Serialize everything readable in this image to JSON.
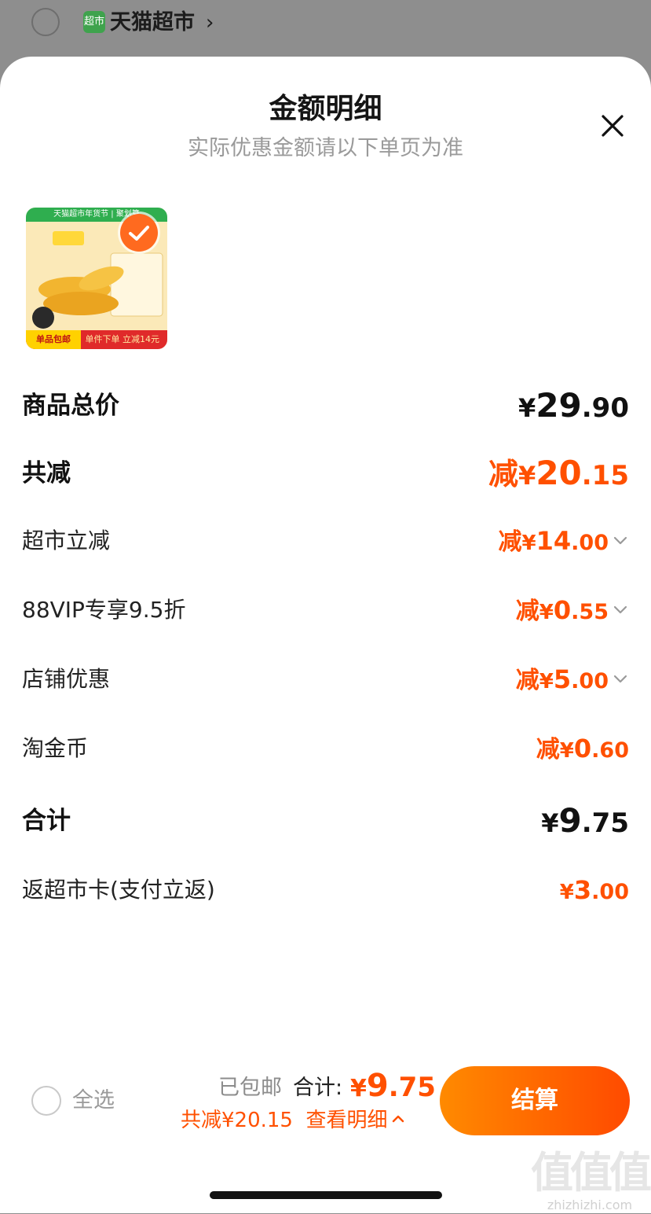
{
  "store": {
    "logo_text": "超市",
    "name": "天猫超市",
    "chevron": "›"
  },
  "sheet": {
    "title": "金额明细",
    "subtitle": "实际优惠金额请以下单页为准",
    "close_icon": "close-icon"
  },
  "product": {
    "banner_top": "天猫超市年货节 | 聚划算",
    "tag": "单品包邮",
    "banner_bottom": "单件下单 立减14元",
    "selected": true,
    "check_icon": "check-icon"
  },
  "rows": [
    {
      "label": "商品总价",
      "prefix": "",
      "symbol": "¥",
      "int": "29",
      "dec": ".90",
      "style": "bold-black",
      "chevron": false
    },
    {
      "label": "共减",
      "prefix": "减",
      "symbol": "¥",
      "int": "20",
      "dec": ".15",
      "style": "bold-orange",
      "chevron": false
    },
    {
      "label": "超市立减",
      "prefix": "减",
      "symbol": "¥",
      "int": "14",
      "dec": ".00",
      "style": "normal-orange",
      "chevron": true
    },
    {
      "label": "88VIP专享9.5折",
      "prefix": "减",
      "symbol": "¥",
      "int": "0",
      "dec": ".55",
      "style": "normal-orange",
      "chevron": true
    },
    {
      "label": "店铺优惠",
      "prefix": "减",
      "symbol": "¥",
      "int": "5",
      "dec": ".00",
      "style": "normal-orange",
      "chevron": true
    },
    {
      "label": "淘金币",
      "prefix": "减",
      "symbol": "¥",
      "int": "0",
      "dec": ".60",
      "style": "normal-orange",
      "chevron": false
    },
    {
      "label": "合计",
      "prefix": "",
      "symbol": "¥",
      "int": "9",
      "dec": ".75",
      "style": "bold-black",
      "chevron": false
    },
    {
      "label": "返超市卡(支付立返)",
      "prefix": "",
      "symbol": "¥",
      "int": "3",
      "dec": ".00",
      "style": "normal-orange",
      "chevron": false
    }
  ],
  "footer": {
    "select_all": "全选",
    "shipping": "已包邮",
    "total_label": "合计:",
    "total_symbol": "¥",
    "total_int": "9",
    "total_dec": ".75",
    "discount": "共减¥20.15",
    "view_detail": "查看明细",
    "checkout": "结算"
  },
  "watermark": {
    "mark": "值值值",
    "url": "zhizhizhi.com"
  },
  "colors": {
    "accent": "#ff5000",
    "checkout_from": "#ff8a00",
    "checkout_to": "#ff4a00",
    "overlay": "#8e8e8e"
  }
}
